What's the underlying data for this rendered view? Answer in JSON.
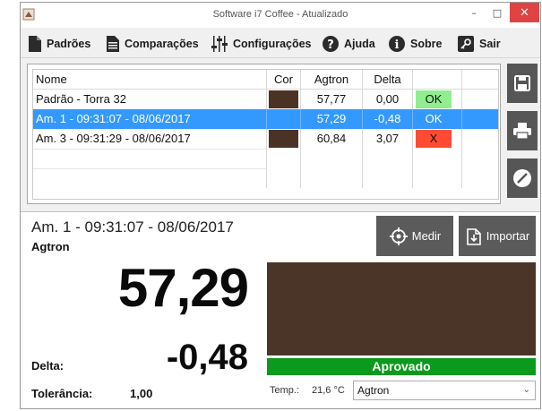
{
  "window": {
    "title": "Software i7 Coffee - Atualizado",
    "controls": {
      "minimize": "–",
      "maximize": "□",
      "close": "✕"
    }
  },
  "menu": [
    {
      "label": "Padrões",
      "icon": "document-icon"
    },
    {
      "label": "Comparações",
      "icon": "list-document-icon"
    },
    {
      "label": "Configurações",
      "icon": "sliders-icon"
    },
    {
      "label": "Ajuda",
      "icon": "help-icon"
    },
    {
      "label": "Sobre",
      "icon": "info-icon"
    },
    {
      "label": "Sair",
      "icon": "exit-icon"
    }
  ],
  "table": {
    "headers": {
      "name": "Nome",
      "color": "Cor",
      "agtron": "Agtron",
      "delta": "Delta"
    },
    "rows": [
      {
        "name": "Padrão - Torra 32",
        "color": "#4a3225",
        "agtron": "57,77",
        "delta": "0,00",
        "status": "OK",
        "selected": false
      },
      {
        "name": "Am. 1 - 09:31:07 - 08/06/2017",
        "color": "#3399ff",
        "agtron": "57,29",
        "delta": "-0,48",
        "status": "OK",
        "selected": true
      },
      {
        "name": "Am. 3 - 09:31:29 - 08/06/2017",
        "color": "#4a3225",
        "agtron": "60,84",
        "delta": "3,07",
        "status": "X",
        "selected": false
      }
    ]
  },
  "side_buttons": [
    {
      "icon": "save-icon"
    },
    {
      "icon": "print-icon"
    },
    {
      "icon": "cancel-icon"
    }
  ],
  "detail": {
    "sample_title": "Am. 1 - 09:31:07 - 08/06/2017",
    "scale_label": "Agtron",
    "value": "57,29",
    "delta_label": "Delta:",
    "delta_value": "-0,48",
    "tolerance_label": "Tolerância:",
    "tolerance_value": "1,00",
    "measure_button": "Medir",
    "import_button": "Importar",
    "preview_color": "#4a3528",
    "approval_text": "Aprovado",
    "approval_color": "#0c9a1d",
    "temp_label": "Temp.:",
    "temp_value": "21,6 °C",
    "scale_select": "Agtron"
  }
}
